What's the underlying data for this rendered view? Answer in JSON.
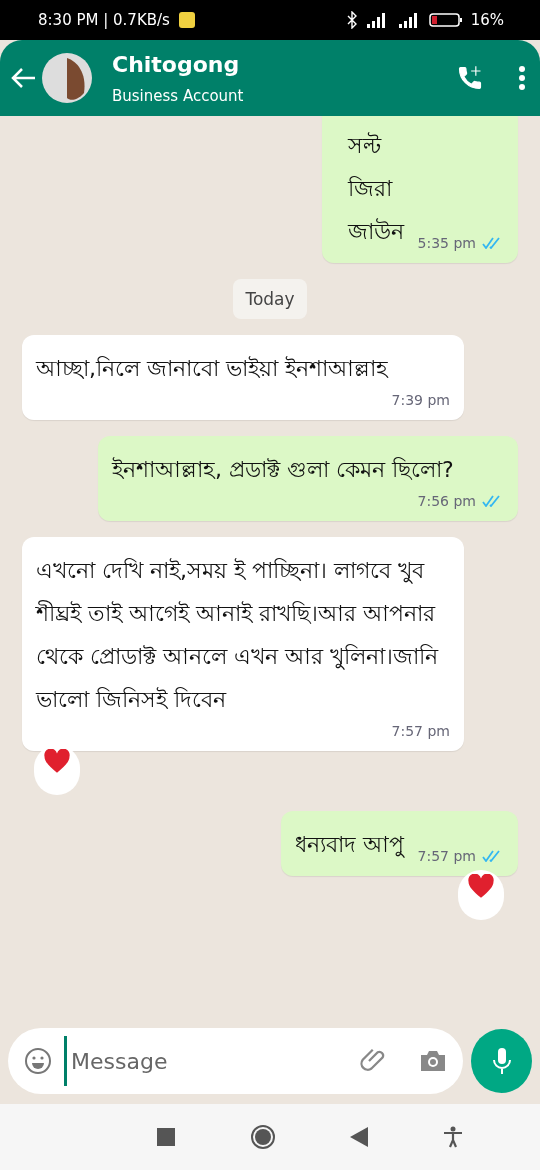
{
  "status_bar": {
    "time": "8:30 PM | 0.7KB/s",
    "battery": "16%"
  },
  "header": {
    "name": "Chitogong",
    "subtitle": "Business Account"
  },
  "messages": [
    {
      "kind": "out",
      "text": "সল্ট\nজিরা\nজাউন",
      "time": "5:35 pm",
      "read": true,
      "reacted": false
    },
    {
      "kind": "date",
      "text": "Today"
    },
    {
      "kind": "in",
      "text": "আচ্ছা,নিলে জানাবো ভাইয়া ইনশাআল্লাহ",
      "time": "7:39 pm",
      "reacted": false
    },
    {
      "kind": "out",
      "text": "ইনশাআল্লাহ, প্রডাক্ট গুলা কেমন ছিলো?",
      "time": "7:56 pm",
      "read": true,
      "reacted": false
    },
    {
      "kind": "in",
      "text": "এখনো দেখি নাই,সময় ই পাচ্ছিনা। লাগবে খুব শীঘ্রই তাই আগেই আনাই রাখছি।আর আপনার থেকে প্রোডাক্ট আনলে এখন আর খুলিনা।জানি ভালো জিনিসই দিবেন",
      "time": "7:57 pm",
      "reacted": true
    },
    {
      "kind": "out",
      "text": "ধন্যবাদ আপু",
      "time": "7:57 pm",
      "read": true,
      "reacted": true
    }
  ],
  "composer": {
    "placeholder": "Message"
  }
}
